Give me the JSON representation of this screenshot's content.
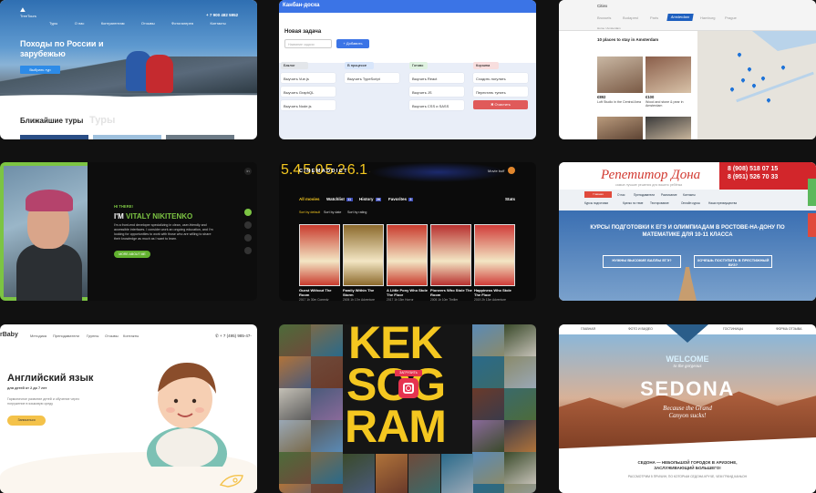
{
  "tours_site": {
    "logo": "TreeTours",
    "nav": [
      "Туры",
      "О нас",
      "Контрагентам",
      "Отзывы",
      "Фотогалерея",
      "Контакты"
    ],
    "phone": "+ 7 900 482 5952",
    "hero_title": "Походы по России и зарубежью",
    "hero_button": "Выбрать тур",
    "section_title": "Ближайшие туры",
    "section_ghost": "Туры"
  },
  "kanban": {
    "title": "Канбан-доска",
    "new_task_title": "Новая задача",
    "input_placeholder": "Название задачи",
    "add_button": "+ Добавить",
    "columns": [
      {
        "name": "Бэклог",
        "color": "#e3e6ea",
        "items": [
          "Выучить Vue.js",
          "Выучить GraphQL",
          "Выучить Node.js"
        ]
      },
      {
        "name": "В процессе",
        "color": "#d8e6fb",
        "items": [
          "Выучить TypeScript"
        ]
      },
      {
        "name": "Готово",
        "color": "#dff2e0",
        "items": [
          "Выучить React",
          "Выучить JS",
          "Выучить CSS и SASS"
        ]
      },
      {
        "name": "Корзина",
        "color": "#f8dede",
        "items": [
          "Сходить погулять",
          "Перестать тупить"
        ],
        "clear": "✖ Очистить"
      }
    ]
  },
  "amsterdam": {
    "brand": "Citiex",
    "tabs": [
      "Brussels",
      "Budapest",
      "Paris",
      "Amsterdam",
      "Hamburg",
      "Prague"
    ],
    "active_tab": "Amsterdam",
    "breadcrumb": "Home / Amsterdam",
    "title": "10 places to stay in Amsterdam",
    "listings": [
      {
        "price": "€892",
        "desc": "Loft Studio in the Central Area"
      },
      {
        "price": "€100",
        "desc": "Wood and stone & pear in Amsterdam"
      }
    ]
  },
  "portfolio": {
    "greeting": "HI THERE!",
    "name_prefix": "I'M",
    "name": "VITALY NIKITENKO",
    "bio": "I'm a front-end developer specializing in clean, user-friendly and accessible interfaces. I consider work an ongoing education, and I'm looking for opportunities to work with those who are willing to share their knowledge as much as I want to learn.",
    "button": "MORE ABOUT ME"
  },
  "cinema": {
    "brand": "CINEMADDICT",
    "user": "Movie buff",
    "filters": [
      {
        "label": "All movies",
        "count": ""
      },
      {
        "label": "Watchlist",
        "count": "11"
      },
      {
        "label": "History",
        "count": "26"
      },
      {
        "label": "Favorites",
        "count": "3"
      }
    ],
    "stats": "Stats",
    "sort": [
      "Sort by default",
      "Sort by date",
      "Sort by rating"
    ],
    "movies": [
      {
        "title": "Guest Without The Room",
        "rating": "5.4",
        "meta": "2017  1h 30m  Comedy",
        "color": "#c93b2e"
      },
      {
        "title": "Family Within The Storm",
        "rating": "5.0",
        "meta": "2005  1h 17m  Adventure",
        "color": "#8c6a2c"
      },
      {
        "title": "A Little Pony Who Stole The Floor",
        "rating": "5.2",
        "meta": "2017  1h 15m  Horror",
        "color": "#c93b2e"
      },
      {
        "title": "Pioneers Who Stole The Room",
        "rating": "6.1",
        "meta": "2005  1h 10m  Thriller",
        "color": "#b8302f"
      },
      {
        "title": "Happiness Who Stole The Floor",
        "rating": "5.4",
        "meta": "2019  2h 13m  Adventure",
        "color": "#d03c39"
      }
    ]
  },
  "tutor": {
    "logo": "Репетитор Дона",
    "sublogo": "самые лучшие решения для вашего ребёнка",
    "phones": [
      "8 (908) 518 07 15",
      "8 (951) 526 70 33"
    ],
    "nav": [
      "Главная",
      "О нас",
      "Преподаватели",
      "Расписание",
      "Контакты",
      "Курсы подготовки",
      "Кратко по теме",
      "Тестирование",
      "Онлайн курсы",
      "Наши преимущества"
    ],
    "headline": "КУРСЫ ПОДГОТОВКИ К ЕГЭ И ОЛИМПИАДАМ В РОСТОВЕ-НА-ДОНУ ПО МАТЕМАТИКЕ ДЛЯ 10-11 КЛАССА",
    "box1": "НУЖНЫ ВЫСОКИЕ БАЛЛЫ ЕГЭ?",
    "box2": "ХОЧЕШЬ ПОСТУПИТЬ В ПРЕСТИЖНЫЙ ВУЗ?"
  },
  "baby": {
    "logo": "rBaby",
    "nav": [
      "Методика",
      "Преподаватели",
      "Группы",
      "Отзывы",
      "Контакты"
    ],
    "phone": "+ 7 (495) 985-47-",
    "title": "Английский язык",
    "subtitle": "для детей от 2 до 7 лет",
    "text": "Гармоничное развитие детей и обучение через погружение в языковую среду",
    "button": "Записаться"
  },
  "kekogram": {
    "word1": "KEK",
    "word2": "SOG",
    "word3": "RAM",
    "button": "ЗАГРУЗИТЬ"
  },
  "sedona": {
    "nav": [
      "ГЛАВНАЯ",
      "ФОТО И ВИДЕО",
      "ГОСТИНИЦЫ",
      "ФОРМА ОТЗЫВА"
    ],
    "welcome": "WELCOME",
    "script": "to the gorgeous",
    "title": "SEDONA",
    "tagline": "Because the Grand Canyon sucks!",
    "caption": "СЕДОНА — НЕБОЛЬШОЙ ГОРОДОК В АРИЗОНЕ, ЗАСЛУЖИВАЮЩИЙ БОЛЬШЕГО!",
    "caption2": "РАССМОТРИМ 5 ПРИЧИН, ПО КОТОРЫМ СЕДОНА КРУЧЕ, ЧЕМ ГРАНД КАНЬОН"
  }
}
